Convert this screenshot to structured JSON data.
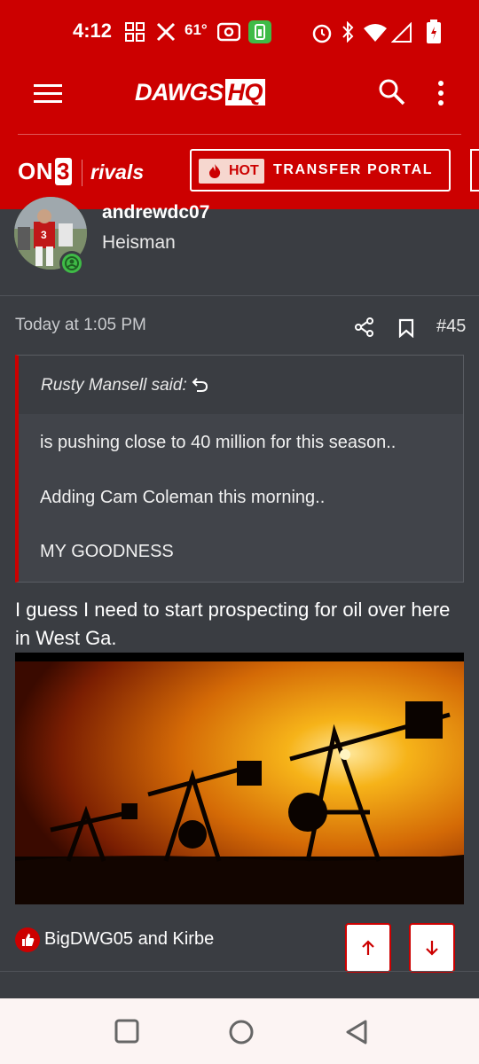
{
  "status_bar": {
    "time": "4:12",
    "temperature": "61°",
    "icons": [
      "grid-icon",
      "x-icon",
      "camera-icon",
      "battery-saver-icon",
      "alarm-icon",
      "bluetooth-icon",
      "wifi-icon",
      "signal-icon",
      "battery-icon"
    ]
  },
  "header": {
    "logo_main": "DAWGS",
    "logo_suffix": "HQ",
    "icons": [
      "menu-icon",
      "search-icon",
      "more-vert-icon"
    ],
    "accent_color": "#cc0000"
  },
  "subnav": {
    "on3_prefix": "ON",
    "on3_suffix": "3",
    "rivals": "rivals",
    "hot_label": "HOT",
    "portal_label": "TRANSFER PORTAL"
  },
  "post_author": {
    "username": "andrewdc07",
    "title": "Heisman"
  },
  "post": {
    "timestamp": "Today at 1:05 PM",
    "number": "#45",
    "quote": {
      "author": "Rusty Mansell said:",
      "lines": [
        "is pushing close to 40 million for this season..",
        "Adding Cam Coleman this morning..",
        "MY GOODNESS"
      ]
    },
    "body": "I guess I need to start prospecting for oil over here in West Ga.",
    "reactions": "BigDWG05 and Kirbe"
  },
  "system_nav": [
    "recents-icon",
    "home-icon",
    "back-icon"
  ]
}
